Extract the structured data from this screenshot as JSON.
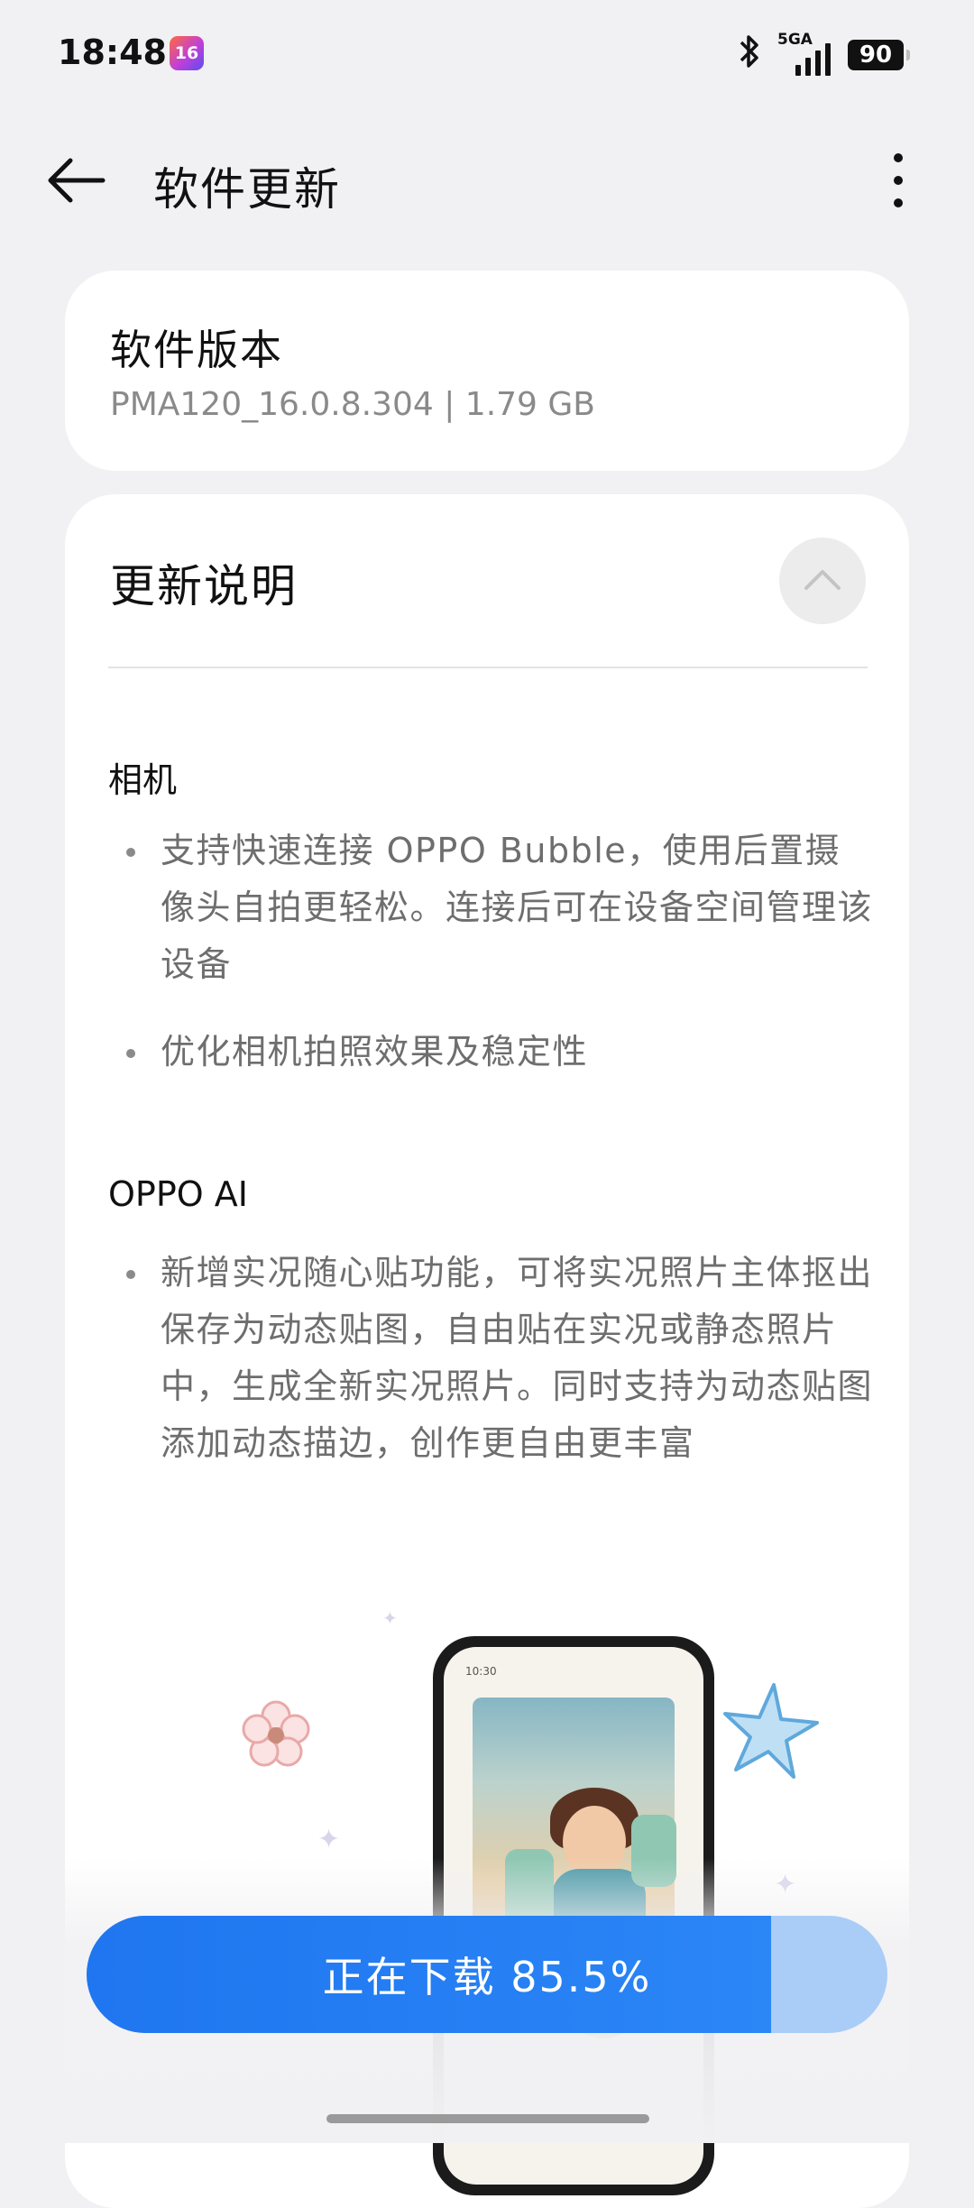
{
  "status_bar": {
    "time": "18:48",
    "os_badge": "16",
    "network": "5GA",
    "battery": "90"
  },
  "app_bar": {
    "title": "软件更新"
  },
  "version_card": {
    "title": "软件版本",
    "detail": "PMA120_16.0.8.304 | 1.79 GB"
  },
  "notes_card": {
    "title": "更新说明",
    "sections": [
      {
        "heading": "相机",
        "items": [
          "支持快速连接 OPPO Bubble，使用后置摄像头自拍更轻松。连接后可在设备空间管理该设备",
          "优化相机拍照效果及稳定性"
        ]
      },
      {
        "heading": "OPPO AI",
        "items": [
          "新增实况随心贴功能，可将实况照片主体抠出保存为动态贴图，自由贴在实况或静态照片中，生成全新实况照片。同时支持为动态贴图添加动态描边，创作更自由更丰富"
        ]
      }
    ],
    "illustration": {
      "phone_time": "10:30"
    }
  },
  "download": {
    "label": "正在下载 85.5%",
    "progress": 0.855
  },
  "colors": {
    "accent": "#1f76f0",
    "progress_track": "#a9cdf7",
    "background": "#f1f1f3"
  }
}
